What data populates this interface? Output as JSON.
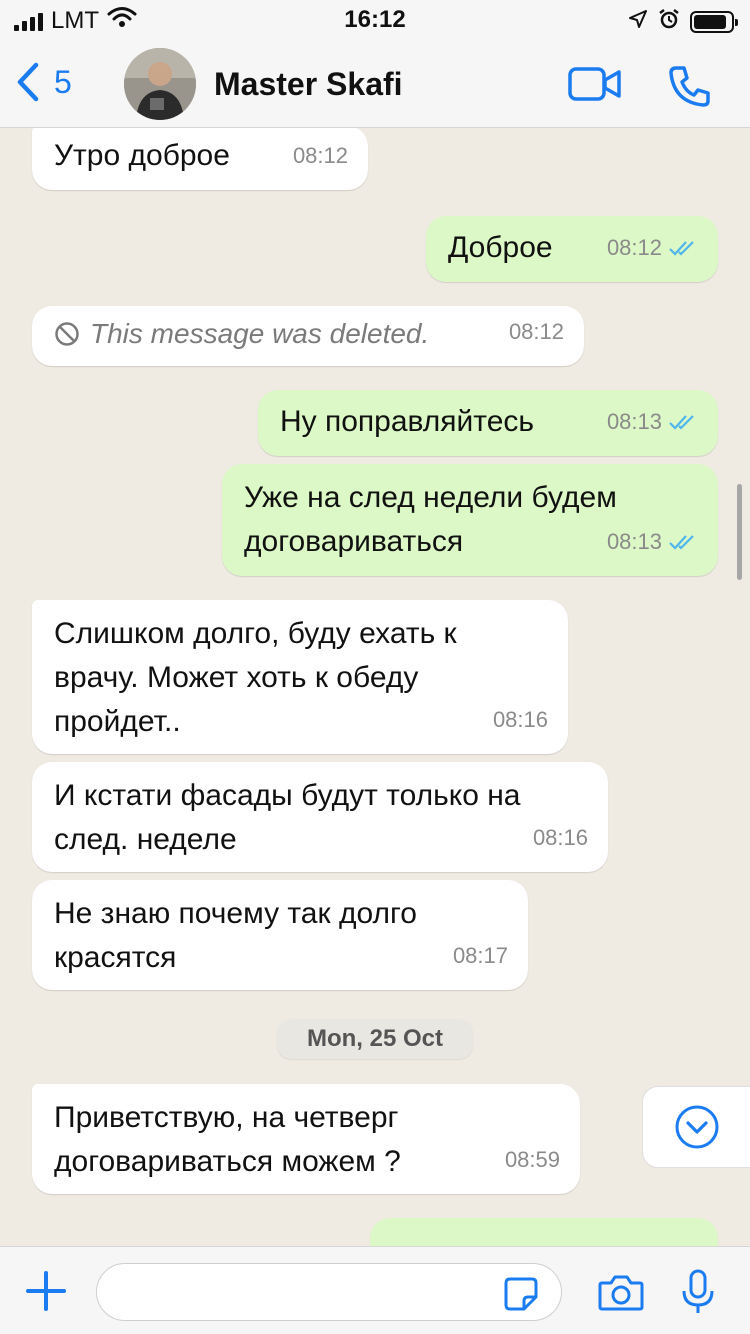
{
  "status_bar": {
    "carrier": "LMT",
    "time": "16:12",
    "battery_level": 0.9,
    "icons": [
      "signal-icon",
      "wifi-icon",
      "location-arrow-icon",
      "alarm-icon",
      "battery-icon"
    ]
  },
  "header": {
    "back_count": "5",
    "contact_name": "Master Skafi",
    "icons": [
      "back-chevron-icon",
      "video-call-icon",
      "voice-call-icon"
    ],
    "accent_color": "#1a7cf0"
  },
  "messages": [
    {
      "direction": "in",
      "text": "Утро доброе",
      "time": "08:12"
    },
    {
      "direction": "out",
      "text": "Доброе",
      "time": "08:12",
      "status": "read"
    },
    {
      "direction": "in",
      "deleted": true,
      "text": "This message was deleted.",
      "time": "08:12"
    },
    {
      "direction": "out",
      "text": "Ну поправляйтесь",
      "time": "08:13",
      "status": "read"
    },
    {
      "direction": "out",
      "text": "Уже на след недели будем договариваться",
      "time": "08:13",
      "status": "read"
    },
    {
      "direction": "in",
      "text": "Слишком долго, буду ехать к врачу. Может хоть к обеду пройдет..",
      "time": "08:16"
    },
    {
      "direction": "in",
      "text": "И кстати фасады будут только на след. неделе",
      "time": "08:16"
    },
    {
      "direction": "in",
      "text": "Не знаю почему так долго красятся",
      "time": "08:17"
    },
    {
      "direction": "in",
      "text": "Приветствую, на четверг договариваться можем ?",
      "time": "08:59"
    }
  ],
  "date_separator": "Mon, 25 Oct",
  "colors": {
    "outgoing_bubble": "#dcf8c6",
    "incoming_bubble": "#ffffff",
    "chat_background": "#efeae2",
    "read_ticks": "#4fb6ec"
  },
  "input_bar": {
    "placeholder": "",
    "icons": [
      "plus-icon",
      "sticker-icon",
      "camera-icon",
      "microphone-icon"
    ]
  }
}
